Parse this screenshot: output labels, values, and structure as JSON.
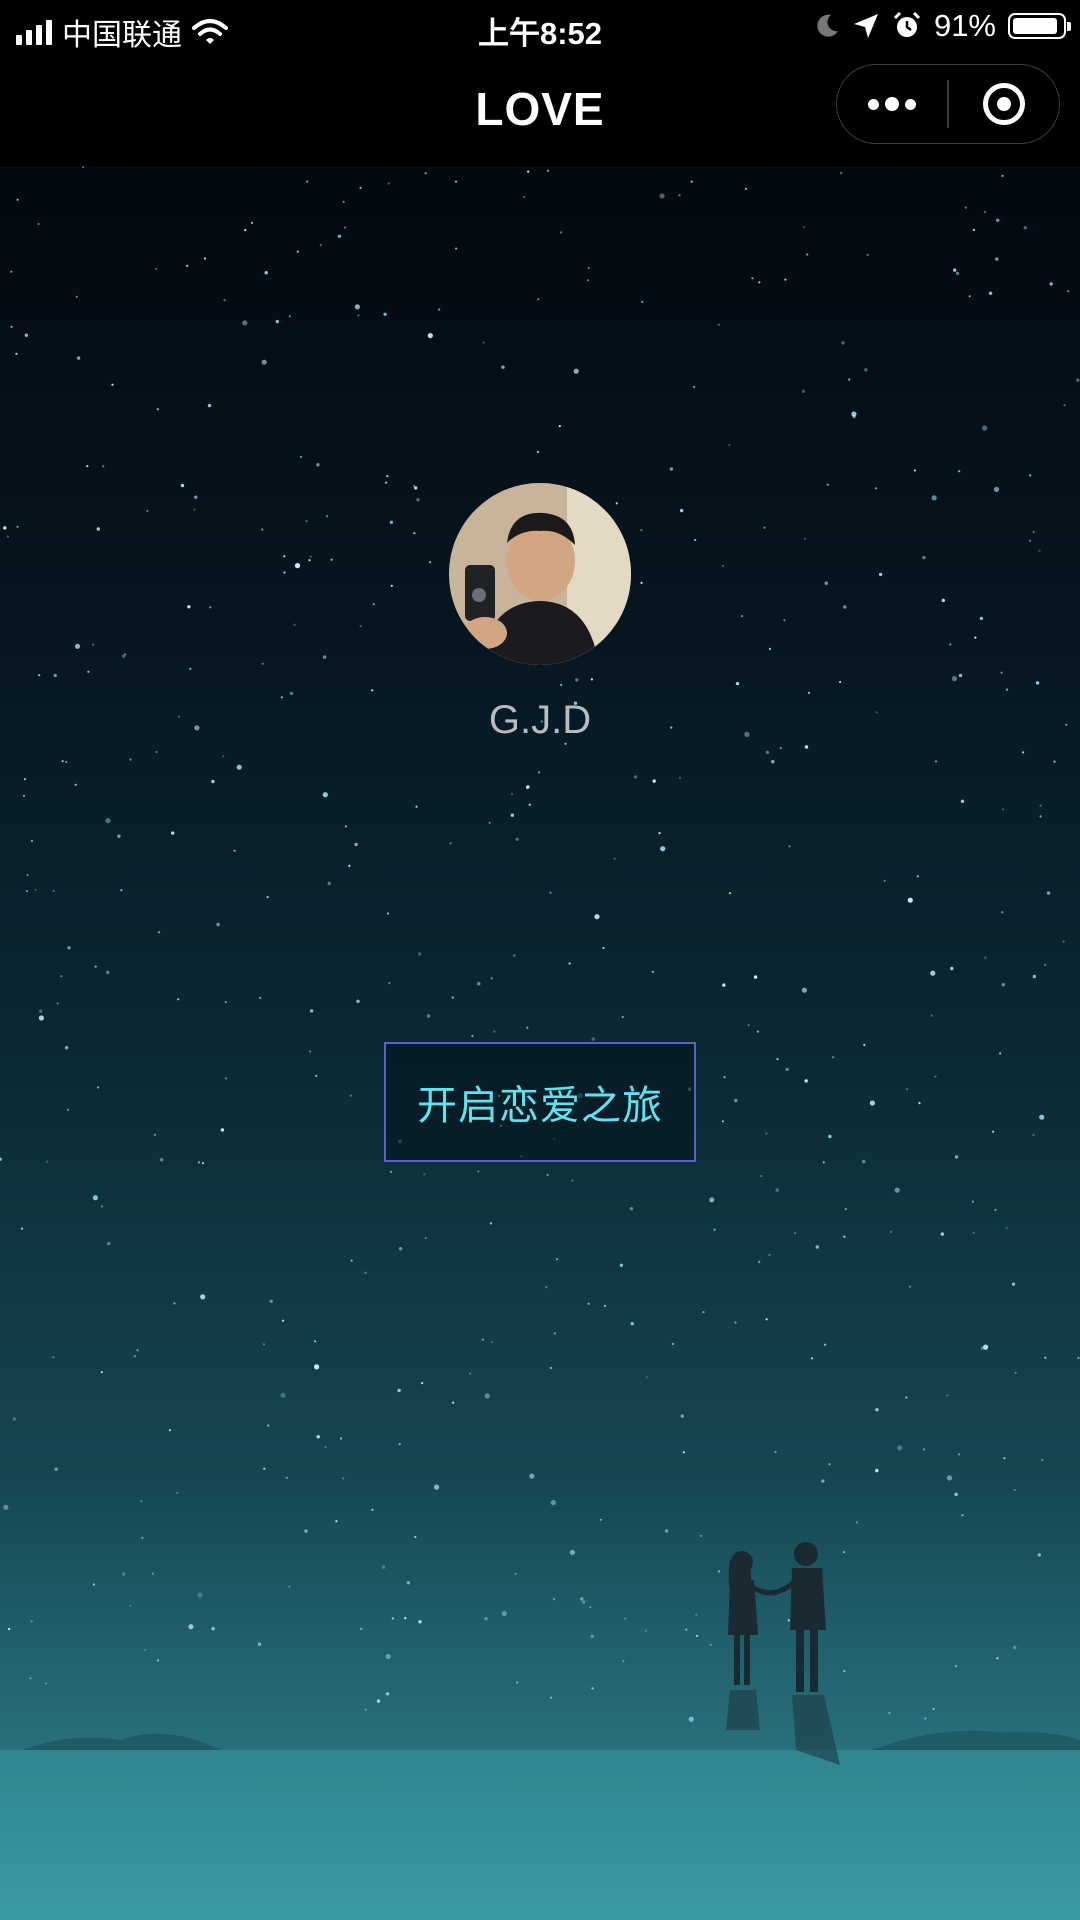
{
  "status_bar": {
    "carrier": "中国联通",
    "time": "上午8:52",
    "battery_percent": "91%",
    "battery_level": 0.91,
    "icons": [
      "signal-icon",
      "wifi-icon",
      "moon-icon",
      "location-icon",
      "alarm-icon",
      "battery-icon"
    ]
  },
  "nav_bar": {
    "title": "LOVE",
    "capsule_icons": [
      "more-icon",
      "close-miniprogram-icon"
    ]
  },
  "profile": {
    "name": "G.J.D"
  },
  "main": {
    "start_button_label": "开启恋爱之旅"
  },
  "colors": {
    "button_text": "#5fe3f0",
    "button_border": "#5b5fc7",
    "sky_top": "#03090f",
    "ground": "#348894"
  }
}
